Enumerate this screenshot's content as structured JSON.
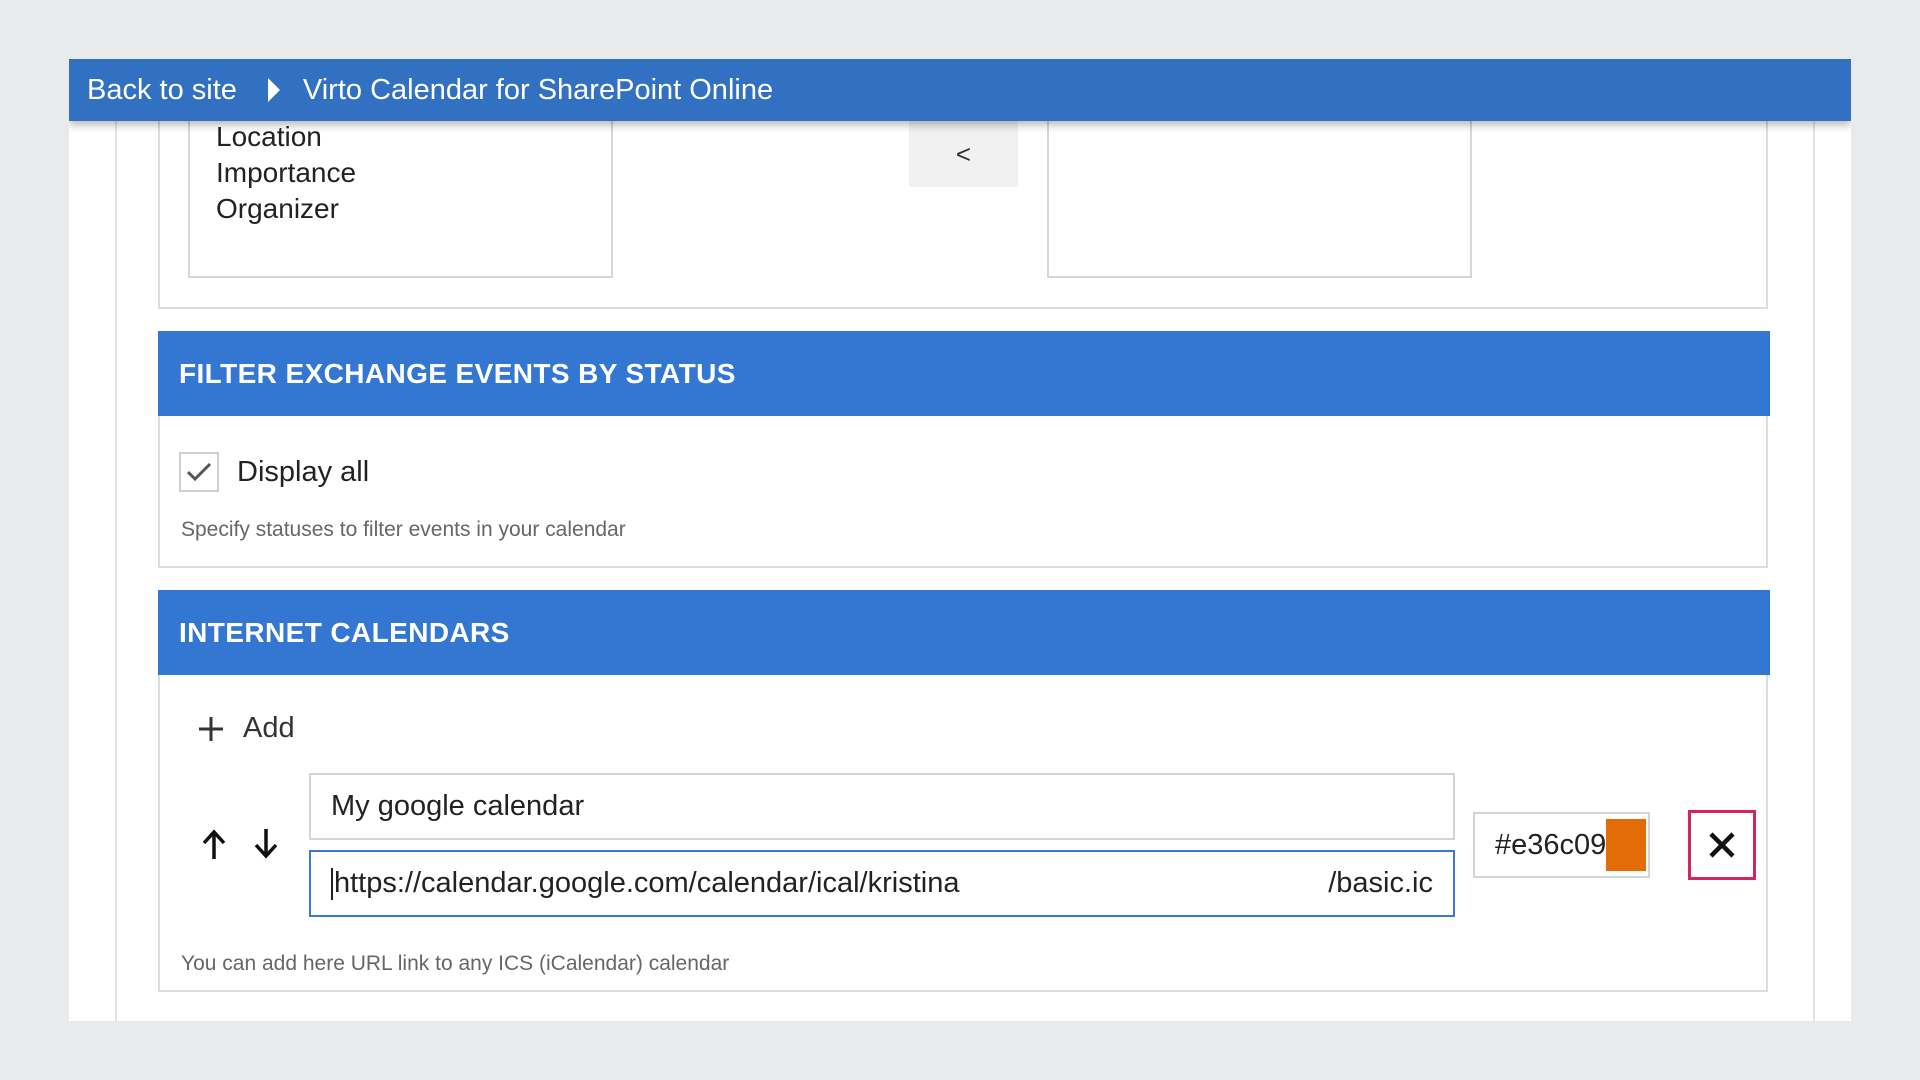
{
  "topbar": {
    "back_label": "Back to site",
    "title": "Virto Calendar for SharePoint Online"
  },
  "fields_section": {
    "available_fields": [
      "Location",
      "Importance",
      "Organizer"
    ],
    "move_left_label": "<"
  },
  "filter_section": {
    "title": "FILTER EXCHANGE EVENTS BY STATUS",
    "display_all_label": "Display all",
    "display_all_checked": true,
    "help_text": "Specify statuses to filter events in your calendar"
  },
  "internet_calendars": {
    "title": "INTERNET CALENDARS",
    "add_label": "Add",
    "help_text": "You can add here URL link to any ICS (iCalendar) calendar",
    "items": [
      {
        "name": "My google calendar",
        "url_start": "https://calendar.google.com/calendar/ical/kristina",
        "url_end": "/basic.ic",
        "color_value": "#e36c09",
        "color_swatch": "#e36c09"
      }
    ]
  },
  "colors": {
    "topbar": "#3270c2",
    "section_header": "#3477d2",
    "remove_button_border": "#d3245c"
  },
  "icons": {
    "breadcrumb_separator": "caret-right-icon",
    "checkbox": "checkmark-icon",
    "add": "plus-icon",
    "move_up": "arrow-up-icon",
    "move_down": "arrow-down-icon",
    "remove": "close-icon"
  }
}
